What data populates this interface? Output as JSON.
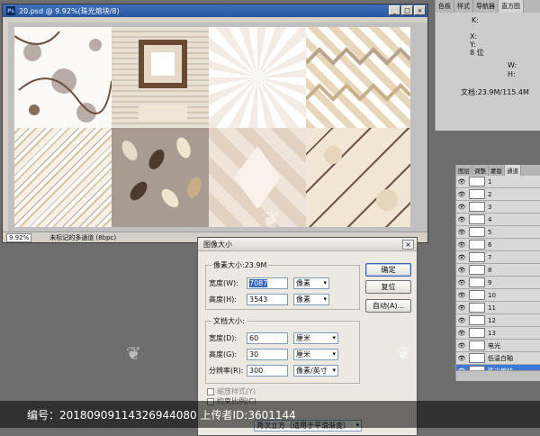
{
  "document": {
    "title": "20.psd @ 9.92%(珠光熔块/8)",
    "app_icon": "Ps",
    "zoom": "9.92%",
    "status": "未标记的多通道 (8bpc)",
    "win_min": "_",
    "win_max": "□",
    "win_close": "×"
  },
  "info_panel": {
    "tabs": [
      "色板",
      "样式",
      "导航器",
      "直方图"
    ],
    "k_label": "K:",
    "bit_label": "8 位",
    "doc_size": "文档:23.9M/115.4M",
    "x_label": "X:",
    "y_label": "Y:",
    "w_label": "W:",
    "h_label": "H:"
  },
  "layers_panel": {
    "tabs": [
      "图层",
      "调整",
      "蒙版",
      "通道"
    ],
    "layers": [
      {
        "name": "1"
      },
      {
        "name": "2"
      },
      {
        "name": "3"
      },
      {
        "name": "4"
      },
      {
        "name": "5"
      },
      {
        "name": "6"
      },
      {
        "name": "7"
      },
      {
        "name": "8"
      },
      {
        "name": "9"
      },
      {
        "name": "10"
      },
      {
        "name": "11"
      },
      {
        "name": "12"
      },
      {
        "name": "13"
      },
      {
        "name": "电光"
      },
      {
        "name": "低温白釉"
      },
      {
        "name": "珠光熔块"
      }
    ],
    "selected_layer": "珠光熔块"
  },
  "dialog": {
    "title": "图像大小",
    "close": "×",
    "pixel_dims_label": "像素大小:23.9M",
    "width_label": "宽度(W):",
    "width_value": "7087",
    "width_unit": "像素",
    "height_label": "高度(H):",
    "height_value": "3543",
    "height_unit": "像素",
    "doc_size_label": "文档大小:",
    "doc_width_label": "宽度(D):",
    "doc_width_value": "60",
    "doc_width_unit": "厘米",
    "doc_height_label": "高度(G):",
    "doc_height_value": "30",
    "doc_height_unit": "厘米",
    "resolution_label": "分辨率(R):",
    "resolution_value": "300",
    "resolution_unit": "像素/英寸",
    "ok": "确定",
    "reset": "复位",
    "auto": "自动(A)...",
    "scale_styles": "缩放样式(Y)",
    "constrain": "约束比例(C)",
    "resample_mode": "两次立方（适用于平滑渐变）"
  },
  "watermark": {
    "text": "编号：20180909114326944080 上传者ID:3601144"
  }
}
